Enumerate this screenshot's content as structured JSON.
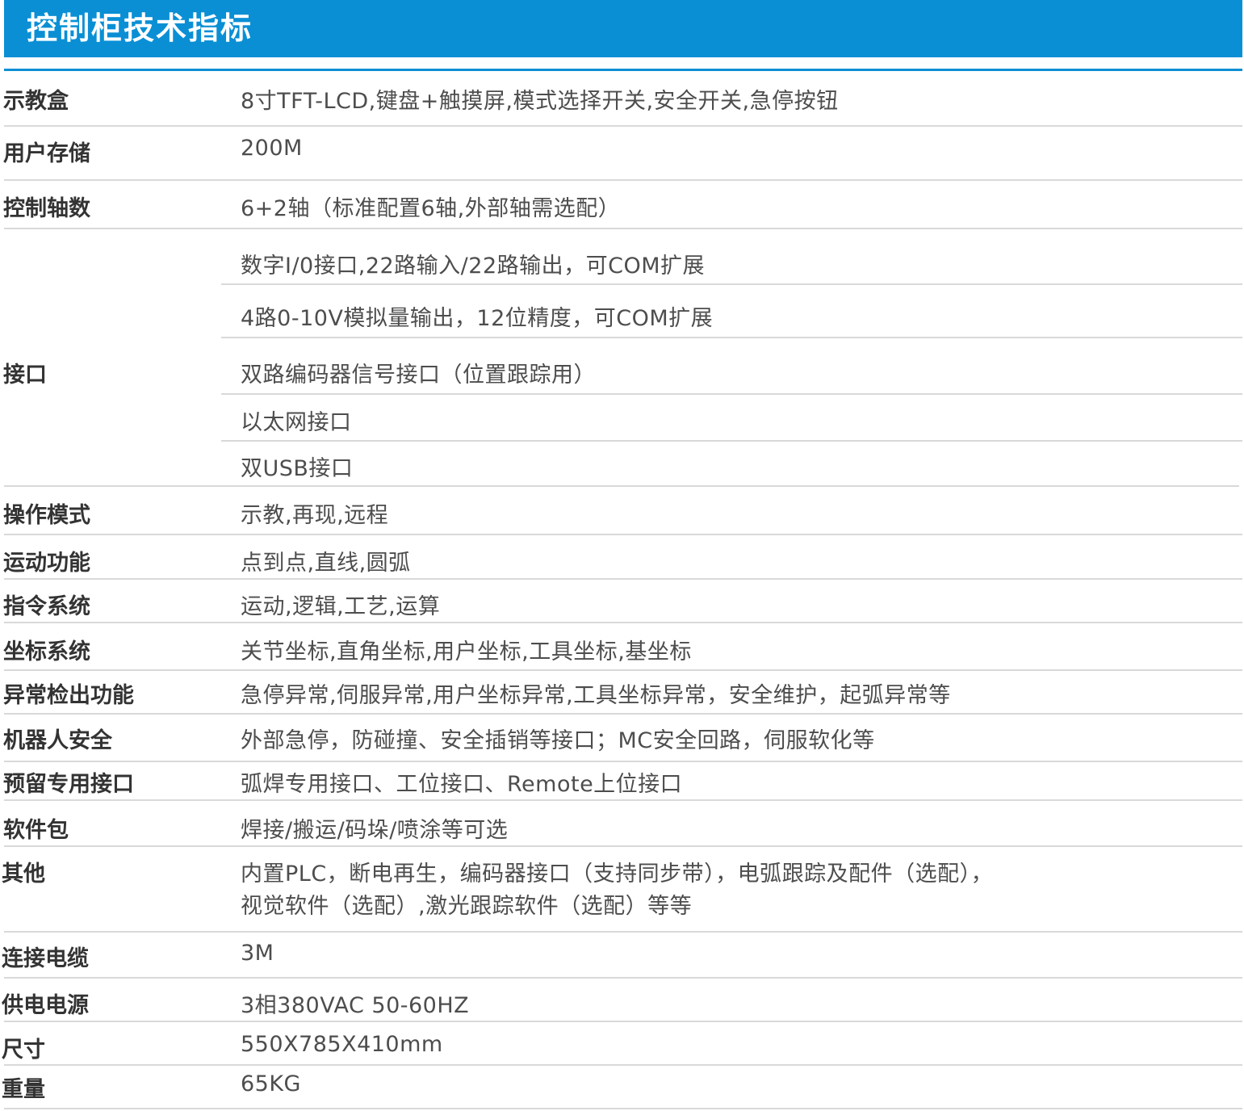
{
  "title": "控制柜技术指标",
  "colors": {
    "header_bg": "#0a8fd5",
    "header_text": "#ffffff",
    "label_text": "#333333",
    "value_text": "#4d4d4d",
    "divider": "#d9d9d9"
  },
  "rows": [
    {
      "label": "示教盒",
      "value": "8寸TFT-LCD,键盘+触摸屏,模式选择开关,安全开关,急停按钮"
    },
    {
      "label": "用户存储",
      "value": "200M"
    },
    {
      "label": "控制轴数",
      "value": "6+2轴（标准配置6轴,外部轴需选配）"
    },
    {
      "label": "接口",
      "values": [
        "数字I/0接口,22路输入/22路输出，可COM扩展",
        "4路0-10V模拟量输出，12位精度，可COM扩展",
        "双路编码器信号接口（位置跟踪用）",
        "以太网接口",
        "双USB接口"
      ]
    },
    {
      "label": "操作模式",
      "value": "示教,再现,远程"
    },
    {
      "label": "运动功能",
      "value": "点到点,直线,圆弧"
    },
    {
      "label": "指令系统",
      "value": "运动,逻辑,工艺,运算"
    },
    {
      "label": "坐标系统",
      "value": "关节坐标,直角坐标,用户坐标,工具坐标,基坐标"
    },
    {
      "label": "异常检出功能",
      "value": "急停异常,伺服异常,用户坐标异常,工具坐标异常，安全维护，起弧异常等"
    },
    {
      "label": "机器人安全",
      "value": "外部急停，防碰撞、安全插销等接口；MC安全回路，伺服软化等"
    },
    {
      "label": "预留专用接口",
      "value": "弧焊专用接口、工位接口、Remote上位接口"
    },
    {
      "label": "软件包",
      "value": "焊接/搬运/码垛/喷涂等可选"
    },
    {
      "label": "其他",
      "lines": [
        "内置PLC，断电再生，编码器接口（支持同步带），电弧跟踪及配件（选配），",
        "视觉软件（选配）,激光跟踪软件（选配）等等"
      ]
    },
    {
      "label": "连接电缆",
      "value": "3M"
    },
    {
      "label": "供电电源",
      "value": "3相380VAC  50-60HZ"
    },
    {
      "label": "尺寸",
      "value": "550X785X410mm"
    },
    {
      "label": "重量",
      "value": "65KG"
    }
  ]
}
